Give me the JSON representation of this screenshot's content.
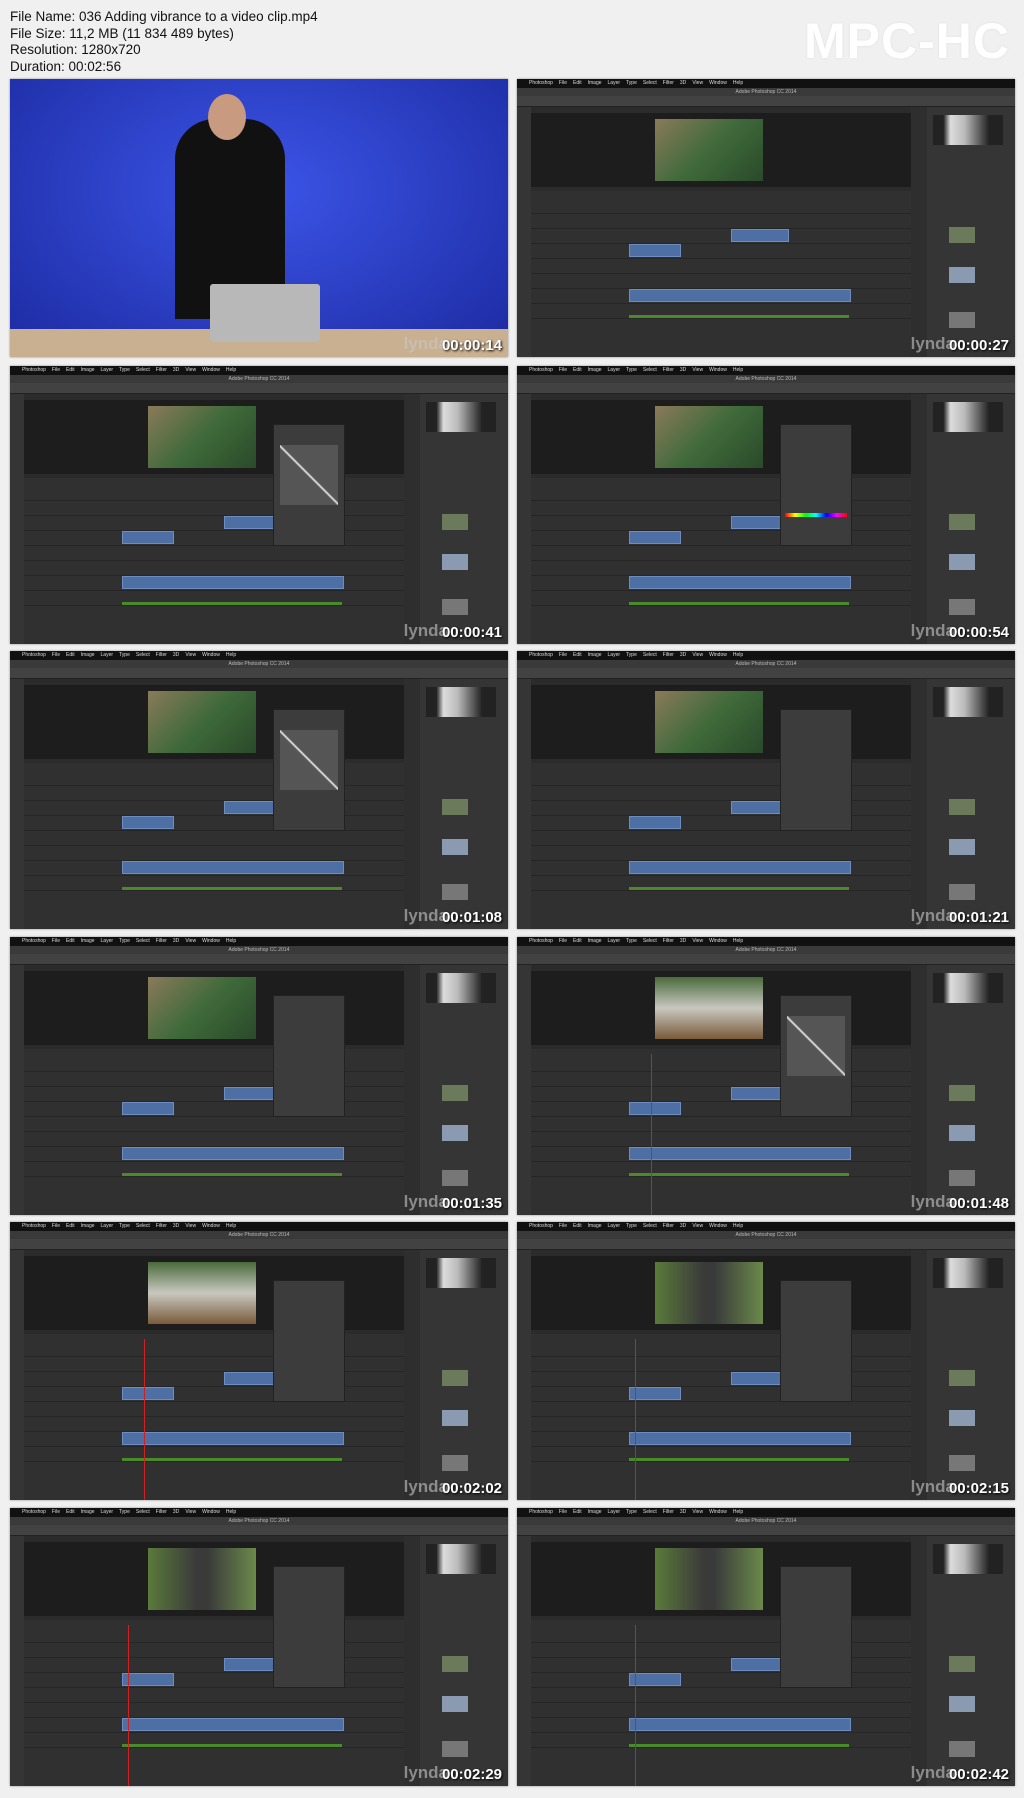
{
  "file_info": {
    "name": "File Name: 036 Adding vibrance to a video clip.mp4",
    "size": "File Size: 11,2 MB (11 834 489 bytes)",
    "resolution": "Resolution: 1280x720",
    "duration": "Duration: 00:02:56"
  },
  "logo": "MPC-HC",
  "app": {
    "menu": [
      "Photoshop",
      "File",
      "Edit",
      "Image",
      "Layer",
      "Type",
      "Select",
      "Filter",
      "3D",
      "View",
      "Window",
      "Help"
    ],
    "title": "Adobe Photoshop CC 2014",
    "watermark": "lynda"
  },
  "thumbnails": [
    {
      "time": "00:00:14",
      "scene": "presenter"
    },
    {
      "time": "00:00:27",
      "scene": "kids",
      "panel": "none"
    },
    {
      "time": "00:00:41",
      "scene": "kids",
      "panel": "curves"
    },
    {
      "time": "00:00:54",
      "scene": "kids",
      "panel": "huesat"
    },
    {
      "time": "00:01:08",
      "scene": "kids",
      "panel": "curves"
    },
    {
      "time": "00:01:21",
      "scene": "kids",
      "panel": "vibrance"
    },
    {
      "time": "00:01:35",
      "scene": "kids",
      "panel": "vibrance"
    },
    {
      "time": "00:01:48",
      "scene": "outdoor",
      "panel": "curves"
    },
    {
      "time": "00:02:02",
      "scene": "outdoor",
      "panel": "vibrance"
    },
    {
      "time": "00:02:15",
      "scene": "man",
      "panel": "vibrance"
    },
    {
      "time": "00:02:29",
      "scene": "man",
      "panel": "vibrance"
    },
    {
      "time": "00:02:42",
      "scene": "man",
      "panel": "vibrance"
    }
  ],
  "colors": {
    "presenter_bg": "#2a3fd0",
    "clip_blue": "#4e6fa3",
    "clip_purple": "#7a4fb0",
    "playhead": "#d02020"
  }
}
